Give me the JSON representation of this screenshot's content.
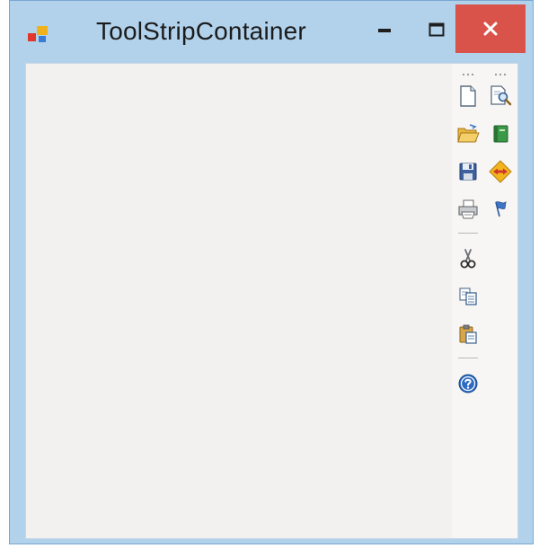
{
  "window": {
    "title": "ToolStripContainer"
  },
  "toolstrip_1": {
    "items": [
      {
        "icon": "new-document-icon"
      },
      {
        "icon": "open-folder-icon"
      },
      {
        "icon": "save-disk-icon"
      },
      {
        "icon": "print-icon"
      },
      {
        "icon": "cut-scissors-icon"
      },
      {
        "icon": "copy-icon"
      },
      {
        "icon": "paste-icon"
      },
      {
        "icon": "help-icon"
      }
    ]
  },
  "toolstrip_2": {
    "items": [
      {
        "icon": "document-search-icon"
      },
      {
        "icon": "green-book-icon"
      },
      {
        "icon": "diamond-arrows-icon"
      },
      {
        "icon": "blue-flag-icon"
      }
    ]
  },
  "colors": {
    "window_frame": "#b2d2ec",
    "close_button": "#d9534a",
    "client_background": "#f2f1f0"
  }
}
